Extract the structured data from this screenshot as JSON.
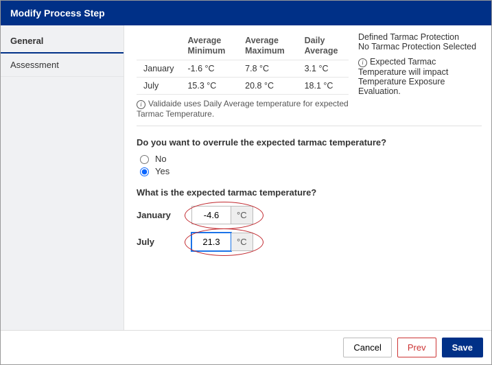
{
  "title": "Modify Process Step",
  "sidebar": {
    "tabs": [
      {
        "label": "General",
        "active": true
      },
      {
        "label": "Assessment",
        "active": false
      }
    ]
  },
  "temps": {
    "headers": {
      "blank": "",
      "avg_min": "Average Minimum",
      "avg_max": "Average Maximum",
      "daily_avg": "Daily Average"
    },
    "rows": [
      {
        "month": "January",
        "avg_min": "-1.6 °C",
        "avg_max": "7.8 °C",
        "daily_avg": "3.1 °C"
      },
      {
        "month": "July",
        "avg_min": "15.3 °C",
        "avg_max": "20.8 °C",
        "daily_avg": "18.1 °C"
      }
    ],
    "footnote": "Validaide uses Daily Average temperature for expected Tarmac Temperature."
  },
  "protection": {
    "header": "Defined Tarmac Protection",
    "value": "No Tarmac Protection Selected",
    "impact": "Expected Tarmac Temperature will impact Temperature Exposure Evaluation."
  },
  "overrule": {
    "question": "Do you want to overrule the expected tarmac temperature?",
    "no": "No",
    "yes": "Yes",
    "selected": "yes"
  },
  "expected": {
    "question": "What is the expected tarmac temperature?",
    "fields": [
      {
        "label": "January",
        "value": "-4.6",
        "unit": "°C",
        "focused": false
      },
      {
        "label": "July",
        "value": "21.3",
        "unit": "°C",
        "focused": true
      }
    ]
  },
  "footer": {
    "cancel": "Cancel",
    "prev": "Prev",
    "save": "Save"
  }
}
